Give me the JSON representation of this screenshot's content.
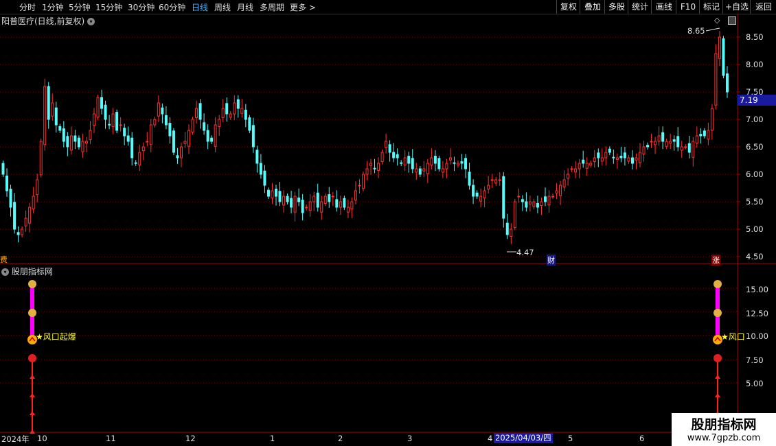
{
  "toolbar": {
    "periods": [
      {
        "label": "分时",
        "active": false
      },
      {
        "label": "1分钟",
        "active": false
      },
      {
        "label": "5分钟",
        "active": false
      },
      {
        "label": "15分钟",
        "active": false
      },
      {
        "label": "30分钟",
        "active": false
      },
      {
        "label": "60分钟",
        "active": false
      },
      {
        "label": "日线",
        "active": true
      },
      {
        "label": "周线",
        "active": false
      },
      {
        "label": "月线",
        "active": false
      },
      {
        "label": "多周期",
        "active": false
      },
      {
        "label": "更多 >",
        "active": false
      }
    ],
    "actions": [
      "复权",
      "叠加",
      "多股",
      "统计",
      "画线",
      "F10",
      "标记",
      "+自选",
      "返回"
    ]
  },
  "main_panel": {
    "title": "阳普医疗(日线,前复权)",
    "high_label": "8.65",
    "low_label": "4.47",
    "current_price": "7.19",
    "markers": {
      "left": "费",
      "cai": "财",
      "zhang": "涨"
    }
  },
  "indicator_panel": {
    "title": "股朋指标网",
    "signal_text_left": "风口起爆",
    "signal_text_right": "风口",
    "yticks": [
      "15.00",
      "12.50",
      "10.00",
      "7.50",
      "5.00"
    ]
  },
  "x_axis": {
    "year": "2024年",
    "months": [
      "10",
      "11",
      "12",
      "1",
      "2",
      "3",
      "4",
      "5",
      "6"
    ],
    "cursor_date": "2025/04/03/四"
  },
  "watermark": {
    "title": "股朋指标网",
    "url": "www.7gpzb.com"
  },
  "colors": {
    "up": "#ff3232",
    "down": "#54fcfc",
    "grid": "#8b0000",
    "magenta": "#ff00ff",
    "signal": "#ffff00"
  },
  "chart_data": {
    "type": "candlestick",
    "title": "阳普医疗(日线,前复权)",
    "ylim": [
      4.4,
      8.8
    ],
    "y_ticks": [
      4.5,
      5.0,
      5.5,
      6.0,
      6.5,
      7.0,
      7.5,
      8.0,
      8.5
    ],
    "high": 8.65,
    "low": 4.47,
    "last": 7.19,
    "closes": [
      6.0,
      5.7,
      5.4,
      5.0,
      4.9,
      5.0,
      5.2,
      5.4,
      5.6,
      5.9,
      6.6,
      7.6,
      7.0,
      7.3,
      6.9,
      6.8,
      6.6,
      6.5,
      6.7,
      6.6,
      6.5,
      6.6,
      6.6,
      6.8,
      7.1,
      7.4,
      7.2,
      7.0,
      6.9,
      7.1,
      6.8,
      6.9,
      6.7,
      6.6,
      6.3,
      6.2,
      6.4,
      6.5,
      6.6,
      6.9,
      7.0,
      7.3,
      7.1,
      6.9,
      6.7,
      6.4,
      6.3,
      6.5,
      6.6,
      6.8,
      7.0,
      7.2,
      7.0,
      6.8,
      6.6,
      6.6,
      6.9,
      7.0,
      7.2,
      7.1,
      7.1,
      7.3,
      7.2,
      7.2,
      7.0,
      6.8,
      6.5,
      6.2,
      6.0,
      5.8,
      5.6,
      5.7,
      5.6,
      5.5,
      5.6,
      5.5,
      5.4,
      5.6,
      5.5,
      5.3,
      5.4,
      5.5,
      5.6,
      5.4,
      5.5,
      5.6,
      5.5,
      5.6,
      5.4,
      5.5,
      5.4,
      5.4,
      5.5,
      5.7,
      5.8,
      6.0,
      6.1,
      6.2,
      6.1,
      6.2,
      6.4,
      6.6,
      6.4,
      6.3,
      6.3,
      6.2,
      6.3,
      6.2,
      6.1,
      6.1,
      6.0,
      6.1,
      6.2,
      6.3,
      6.2,
      6.1,
      6.1,
      6.2,
      6.3,
      6.2,
      6.2,
      6.2,
      6.1,
      5.8,
      5.6,
      5.6,
      5.6,
      5.7,
      5.8,
      5.9,
      5.9,
      5.9,
      5.2,
      4.9,
      5.0,
      5.5,
      5.6,
      5.5,
      5.4,
      5.5,
      5.5,
      5.4,
      5.5,
      5.5,
      5.6,
      5.6,
      5.7,
      5.8,
      5.9,
      6.0,
      6.1,
      6.1,
      6.2,
      6.2,
      6.2,
      6.2,
      6.3,
      6.3,
      6.3,
      6.4,
      6.4,
      6.3,
      6.3,
      6.3,
      6.3,
      6.3,
      6.2,
      6.3,
      6.4,
      6.5,
      6.5,
      6.6,
      6.6,
      6.7,
      6.6,
      6.6,
      6.6,
      6.6,
      6.5,
      6.5,
      6.5,
      6.4,
      6.6,
      6.7,
      6.7,
      6.7,
      6.8,
      7.2,
      8.2,
      8.5,
      7.8,
      7.5
    ]
  }
}
